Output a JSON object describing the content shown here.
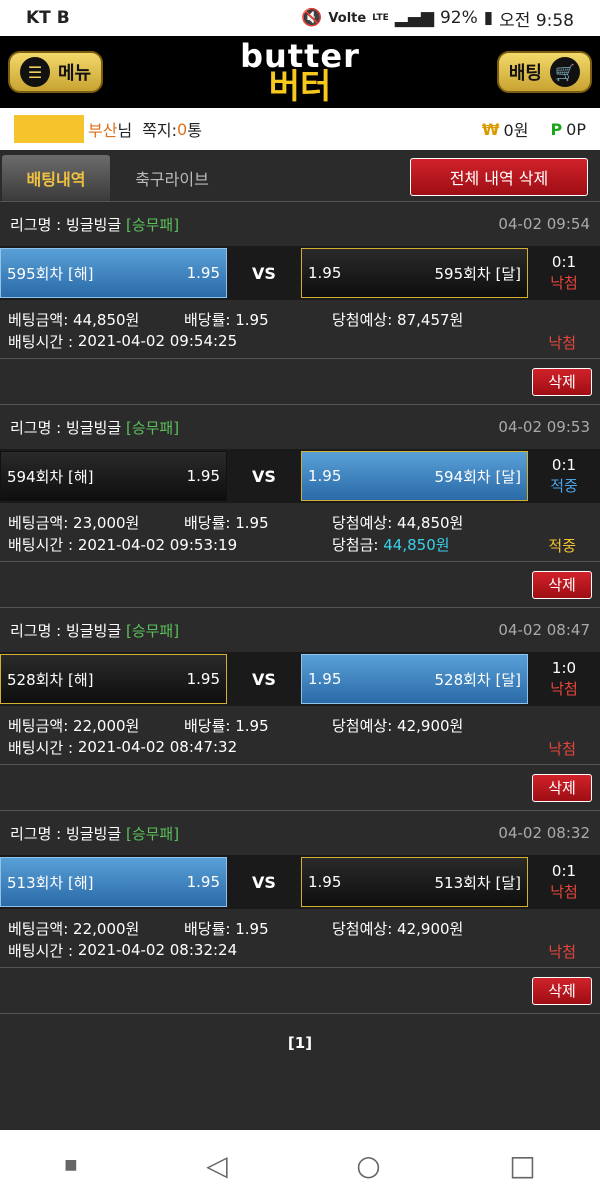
{
  "status_bar": {
    "carrier": "KT",
    "carrier_badge": "B",
    "volte": "Volte",
    "lte": "LTE",
    "battery": "92%",
    "time": "오전 9:58"
  },
  "header": {
    "menu_label": "메뉴",
    "logo_en": "butter",
    "logo_ko": "버터",
    "bet_label": "배팅"
  },
  "user": {
    "location": "부산",
    "suffix": "님",
    "message_label": "쪽지:",
    "message_count": "0",
    "message_unit": "통",
    "won_symbol": "₩",
    "money": "0원",
    "point_symbol": "P",
    "points": "0P"
  },
  "tabs": {
    "betting_history": "배팅내역",
    "soccer_live": "축구라이브",
    "delete_all": "전체 내역 삭제"
  },
  "bets": [
    {
      "league_label": "리그명 : 빙글빙글",
      "league_type": "[승무패]",
      "time": "04-02 09:54",
      "home_name": "595회차 [해]",
      "home_odds": "1.95",
      "vs": "VS",
      "away_odds": "1.95",
      "away_name": "595회차 [달]",
      "score": "0:1",
      "result_top": "낙첨",
      "amount_label": "베팅금액:",
      "amount": "44,850원",
      "odds_label": "배당률:",
      "odds": "1.95",
      "expected_label": "당첨예상:",
      "expected": "87,457원",
      "bet_time_label": "배팅시간 :",
      "bet_time": "2021-04-02 09:54:25",
      "win_label": "",
      "win_amount": "",
      "result": "낙첨",
      "delete": "삭제"
    },
    {
      "league_label": "리그명 : 빙글빙글",
      "league_type": "[승무패]",
      "time": "04-02 09:53",
      "home_name": "594회차 [해]",
      "home_odds": "1.95",
      "vs": "VS",
      "away_odds": "1.95",
      "away_name": "594회차 [달]",
      "score": "0:1",
      "result_top": "적중",
      "amount_label": "베팅금액:",
      "amount": "23,000원",
      "odds_label": "배당률:",
      "odds": "1.95",
      "expected_label": "당첨예상:",
      "expected": "44,850원",
      "bet_time_label": "배팅시간 :",
      "bet_time": "2021-04-02 09:53:19",
      "win_label": "당첨금:",
      "win_amount": "44,850원",
      "result": "적중",
      "delete": "삭제"
    },
    {
      "league_label": "리그명 : 빙글빙글",
      "league_type": "[승무패]",
      "time": "04-02 08:47",
      "home_name": "528회차 [해]",
      "home_odds": "1.95",
      "vs": "VS",
      "away_odds": "1.95",
      "away_name": "528회차 [달]",
      "score": "1:0",
      "result_top": "낙첨",
      "amount_label": "베팅금액:",
      "amount": "22,000원",
      "odds_label": "배당률:",
      "odds": "1.95",
      "expected_label": "당첨예상:",
      "expected": "42,900원",
      "bet_time_label": "배팅시간 :",
      "bet_time": "2021-04-02 08:47:32",
      "win_label": "",
      "win_amount": "",
      "result": "낙첨",
      "delete": "삭제"
    },
    {
      "league_label": "리그명 : 빙글빙글",
      "league_type": "[승무패]",
      "time": "04-02 08:32",
      "home_name": "513회차 [해]",
      "home_odds": "1.95",
      "vs": "VS",
      "away_odds": "1.95",
      "away_name": "513회차 [달]",
      "score": "0:1",
      "result_top": "낙첨",
      "amount_label": "베팅금액:",
      "amount": "22,000원",
      "odds_label": "배당률:",
      "odds": "1.95",
      "expected_label": "당첨예상:",
      "expected": "42,900원",
      "bet_time_label": "배팅시간 :",
      "bet_time": "2021-04-02 08:32:24",
      "win_label": "",
      "win_amount": "",
      "result": "낙첨",
      "delete": "삭제"
    }
  ],
  "pager": "[1]",
  "colors": {
    "accent_gold": "#f7c91e",
    "lose_red": "#e8453c",
    "win_blue": "#4aa4e8",
    "selected_blue": "#3a84c8"
  }
}
